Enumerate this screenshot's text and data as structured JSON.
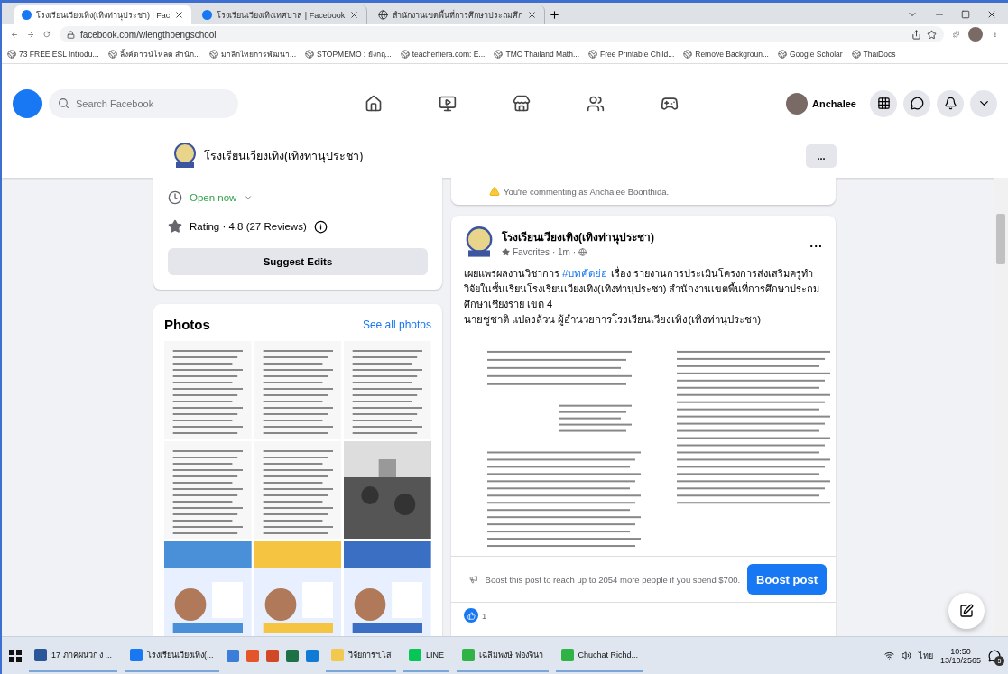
{
  "browser": {
    "tabs": [
      {
        "kind": "facebook",
        "title": "โรงเรียนเวียงเทิง(เทิงท่านุประชา) | Fac",
        "selected": true
      },
      {
        "kind": "facebook",
        "title": "โรงเรียนเวียงเทิงเทศบาล | Facebook",
        "selected": false
      },
      {
        "kind": "globe",
        "title": "สำนักงานเขตพื้นที่การศึกษาประถมศึก",
        "selected": false
      }
    ],
    "address": "facebook.com/wiengthoengschool",
    "bookmarks": [
      "73 FREE ESL Introdu...",
      "ลิ้งค์ดาวน์โหลด สำนัก...",
      "มาลิกไทยการพัฒนา...",
      "STOPMEMO : ยังกฤ...",
      "teacherfiera.com: E...",
      "TMC Thailand Math...",
      "Free Printable Child...",
      "Remove Backgroun...",
      "Google Scholar",
      "ThaiDocs"
    ]
  },
  "facebook_header": {
    "search": {
      "placeholder": "Search Facebook"
    },
    "user": "Anchalee"
  },
  "page_bar": {
    "name": "โรงเรียนเวียงเทิง(เทิงท่านุประชา)",
    "more": "..."
  },
  "about": {
    "open_status": "Open now",
    "rating": "Rating · 4.8 (27 Reviews)",
    "button": "Suggest Edits"
  },
  "photos": {
    "title": "Photos",
    "link": "See all photos"
  },
  "comment_notice": "You're commenting as Anchalee Boonthida.",
  "post": {
    "author": "โรงเรียนเวียงเทิง(เทิงท่านุประชา)",
    "meta": "Favorites · 1m ·",
    "more": "...",
    "text_before": "เผยแพร่ผลงานวิชาการ ",
    "hashtag": "#บทคัดย่อ",
    "text_after": " เรื่อง รายงานการประเมินโครงการส่งเสริมครูทำวิจัยในชั้นเรียนโรงเรียนเวียงเทิง(เทิงท่านุประชา) สำนักงานเขตพื้นที่การศึกษาประถมศึกษาเชียงราย เขต 4",
    "signature": "นายชูชาติ  แปลงล้วน ผู้อำนวยการโรงเรียนเวียงเทิง(เทิงท่านุประชา)",
    "boost_text": "Boost this post to reach up to 2054 more people if you spend $700.",
    "boost_button": "Boost post",
    "likes": "1"
  },
  "taskbar": {
    "apps": [
      {
        "label": "17 ภาคผนวก ง ...",
        "color": "#2b579a"
      },
      {
        "label": "โรงเรียนเวียงเทิง(...",
        "color": "#1877f2"
      },
      {
        "label": "วิจัยการฯ.โส",
        "color": "#f2c94c"
      },
      {
        "label": "LINE",
        "color": "#06c755"
      },
      {
        "label": "เฉลิมพงษ์ ฟองจินา",
        "color": "#2fb344"
      },
      {
        "label": "Chuchat Richd...",
        "color": "#2fb344"
      }
    ],
    "language": "ไทย",
    "time": "10:50",
    "date": "13/10/2565",
    "notifications": "5"
  }
}
